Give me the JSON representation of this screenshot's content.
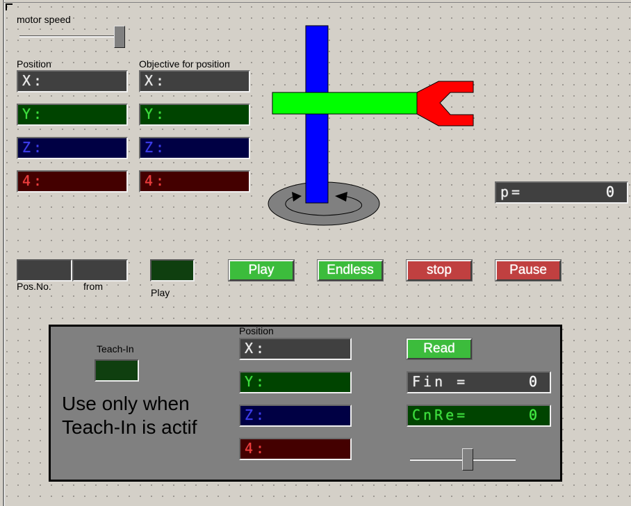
{
  "motor_speed": {
    "label": "motor speed",
    "value_fraction": 1.0
  },
  "position_panel": {
    "label": "Position",
    "x": {
      "prefix": "X:",
      "value": ""
    },
    "y": {
      "prefix": "Y:",
      "value": ""
    },
    "z": {
      "prefix": "Z:",
      "value": ""
    },
    "a4": {
      "prefix": "4:",
      "value": ""
    }
  },
  "objective_panel": {
    "label": "Objective for position",
    "x": {
      "prefix": "X:",
      "value": ""
    },
    "y": {
      "prefix": "Y:",
      "value": ""
    },
    "z": {
      "prefix": "Z:",
      "value": ""
    },
    "a4": {
      "prefix": "4:",
      "value": ""
    }
  },
  "robot_graphic": {
    "colors": {
      "column": "#0000ff",
      "arm": "#00ff00",
      "gripper": "#ff0000",
      "base": "#808080"
    }
  },
  "p_display": {
    "prefix": "p=",
    "value": "0"
  },
  "playback": {
    "pos_no_label": "Pos.No.",
    "from_label": "from",
    "pos_no_value": "",
    "from_value": "",
    "play_led_label": "Play",
    "buttons": {
      "play": "Play",
      "endless": "Endless",
      "stop": "stop",
      "pause": "Pause"
    }
  },
  "teach_in": {
    "led_label": "Teach-In",
    "note_line1": "Use only when",
    "note_line2": "Teach-In is actif",
    "position_label": "Position",
    "x": {
      "prefix": "X:",
      "value": ""
    },
    "y": {
      "prefix": "Y:",
      "value": ""
    },
    "z": {
      "prefix": "Z:",
      "value": ""
    },
    "a4": {
      "prefix": "4:",
      "value": ""
    },
    "read_button": "Read",
    "fin": {
      "prefix": "Fin =",
      "value": "0"
    },
    "cnre": {
      "prefix": "CnRe=",
      "value": "0"
    },
    "slider_value_fraction": 0.55
  },
  "colors": {
    "button_green": "#3cbc3c",
    "button_red": "#c04040",
    "led_off_green": "#0f3f0f",
    "lcd_gray": "#404040",
    "lcd_green": "#004400",
    "lcd_blue": "#000044",
    "lcd_red": "#440000"
  }
}
